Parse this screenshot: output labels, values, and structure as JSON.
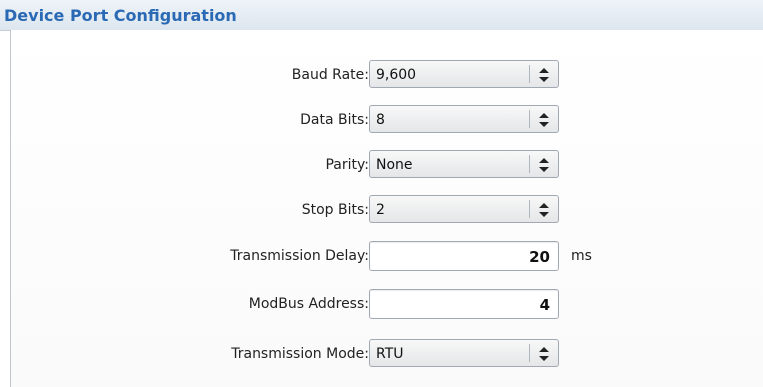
{
  "panel": {
    "title": "Device Port Configuration"
  },
  "fields": {
    "baud_rate": {
      "label": "Baud Rate:",
      "value": "9,600"
    },
    "data_bits": {
      "label": "Data Bits:",
      "value": "8"
    },
    "parity": {
      "label": "Parity:",
      "value": "None"
    },
    "stop_bits": {
      "label": "Stop Bits:",
      "value": "2"
    },
    "transmission_delay": {
      "label": "Transmission Delay:",
      "value": "20",
      "unit": "ms"
    },
    "modbus_address": {
      "label": "ModBus Address:",
      "value": "4"
    },
    "transmission_mode": {
      "label": "Transmission Mode:",
      "value": "RTU"
    }
  },
  "icons": {
    "select_arrow": "updown-arrows-icon"
  },
  "colors": {
    "title": "#2a69b4",
    "header_bg": "#dde6ef",
    "border": "#9fa8b3"
  }
}
